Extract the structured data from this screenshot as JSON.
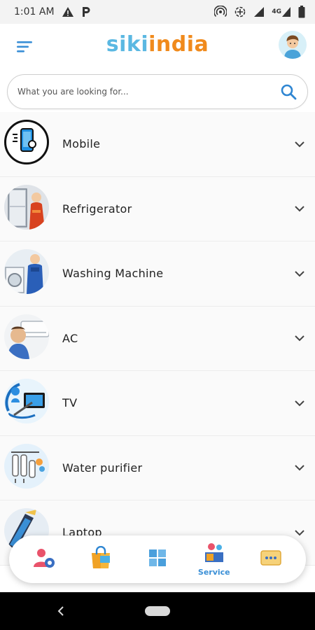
{
  "status_bar": {
    "time": "1:01 AM",
    "network": "4G"
  },
  "header": {
    "brand_part1": "siki",
    "brand_part2": "india",
    "brand_colors": {
      "siki": "#5bb8e2",
      "india": "#f08a1c"
    }
  },
  "search": {
    "placeholder": "What you are looking for...",
    "value": ""
  },
  "categories": [
    {
      "label": "Mobile",
      "icon": "mobile-repair-icon"
    },
    {
      "label": "Refrigerator",
      "icon": "refrigerator-icon"
    },
    {
      "label": "Washing Machine",
      "icon": "washing-machine-icon"
    },
    {
      "label": "AC",
      "icon": "ac-icon"
    },
    {
      "label": "TV",
      "icon": "tv-repair-icon"
    },
    {
      "label": "Water purifier",
      "icon": "water-purifier-icon"
    },
    {
      "label": "Laptop",
      "icon": "laptop-icon"
    }
  ],
  "bottom_nav": {
    "items": [
      {
        "icon": "profile-settings-icon",
        "label": ""
      },
      {
        "icon": "shopping-bag-icon",
        "label": ""
      },
      {
        "icon": "grid-icon",
        "label": ""
      },
      {
        "icon": "service-icon",
        "label": "Service"
      },
      {
        "icon": "more-icon",
        "label": ""
      }
    ],
    "active_color": "#3a8fd6"
  }
}
